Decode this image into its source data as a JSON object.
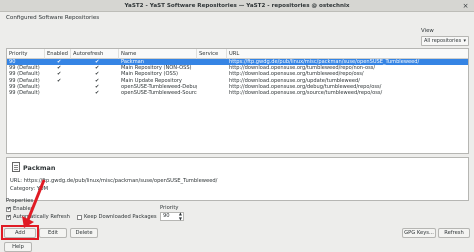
{
  "window": {
    "title": "YaST2 - YaST Software Repositories — YaST2 - repositories @ ostechnix",
    "close_glyph": "×"
  },
  "heading": "Configured Software Repositories",
  "view": {
    "label": "View",
    "selected": "All repositories"
  },
  "table": {
    "columns": [
      "Priority",
      "Enabled",
      "Autorefresh",
      "Name",
      "Service",
      "URL"
    ],
    "rows": [
      {
        "priority": "90",
        "enabled": "✔",
        "autorefresh": "✔",
        "name": "Packman",
        "service": "",
        "url": "https://ftp.gwdg.de/pub/linux/misc/packman/suse/openSUSE_Tumbleweed/",
        "selected": true
      },
      {
        "priority": "99 (Default)",
        "enabled": "✔",
        "autorefresh": "✔",
        "name": "Main Repository (NON-OSS)",
        "service": "",
        "url": "http://download.opensuse.org/tumbleweed/repo/non-oss/",
        "selected": false
      },
      {
        "priority": "99 (Default)",
        "enabled": "✔",
        "autorefresh": "✔",
        "name": "Main Repository (OSS)",
        "service": "",
        "url": "http://download.opensuse.org/tumbleweed/repo/oss/",
        "selected": false
      },
      {
        "priority": "99 (Default)",
        "enabled": "✔",
        "autorefresh": "✔",
        "name": "Main Update Repository",
        "service": "",
        "url": "http://download.opensuse.org/update/tumbleweed/",
        "selected": false
      },
      {
        "priority": "99 (Default)",
        "enabled": "",
        "autorefresh": "✔",
        "name": "openSUSE-Tumbleweed-Debug",
        "service": "",
        "url": "http://download.opensuse.org/debug/tumbleweed/repo/oss/",
        "selected": false
      },
      {
        "priority": "99 (Default)",
        "enabled": "",
        "autorefresh": "✔",
        "name": "openSUSE-Tumbleweed-Source",
        "service": "",
        "url": "http://download.opensuse.org/source/tumbleweed/repo/oss/",
        "selected": false
      }
    ]
  },
  "details": {
    "name": "Packman",
    "url_line": "URL: https://ftp.gwdg.de/pub/linux/misc/packman/suse/openSUSE_Tumbleweed/",
    "category_line": "Category: YUM"
  },
  "properties": {
    "label": "Properties",
    "enabled_label": "Enabled",
    "autorefresh_label": "Automatically Refresh",
    "keep_label": "Keep Downloaded Packages",
    "priority_label": "Priority",
    "priority_value": "90"
  },
  "buttons": {
    "add": "Add",
    "edit": "Edit",
    "delete": "Delete",
    "gpg": "GPG Keys...",
    "refresh": "Refresh",
    "help": "Help"
  },
  "colors": {
    "selection": "#3584e4",
    "highlight": "#e01b24"
  }
}
